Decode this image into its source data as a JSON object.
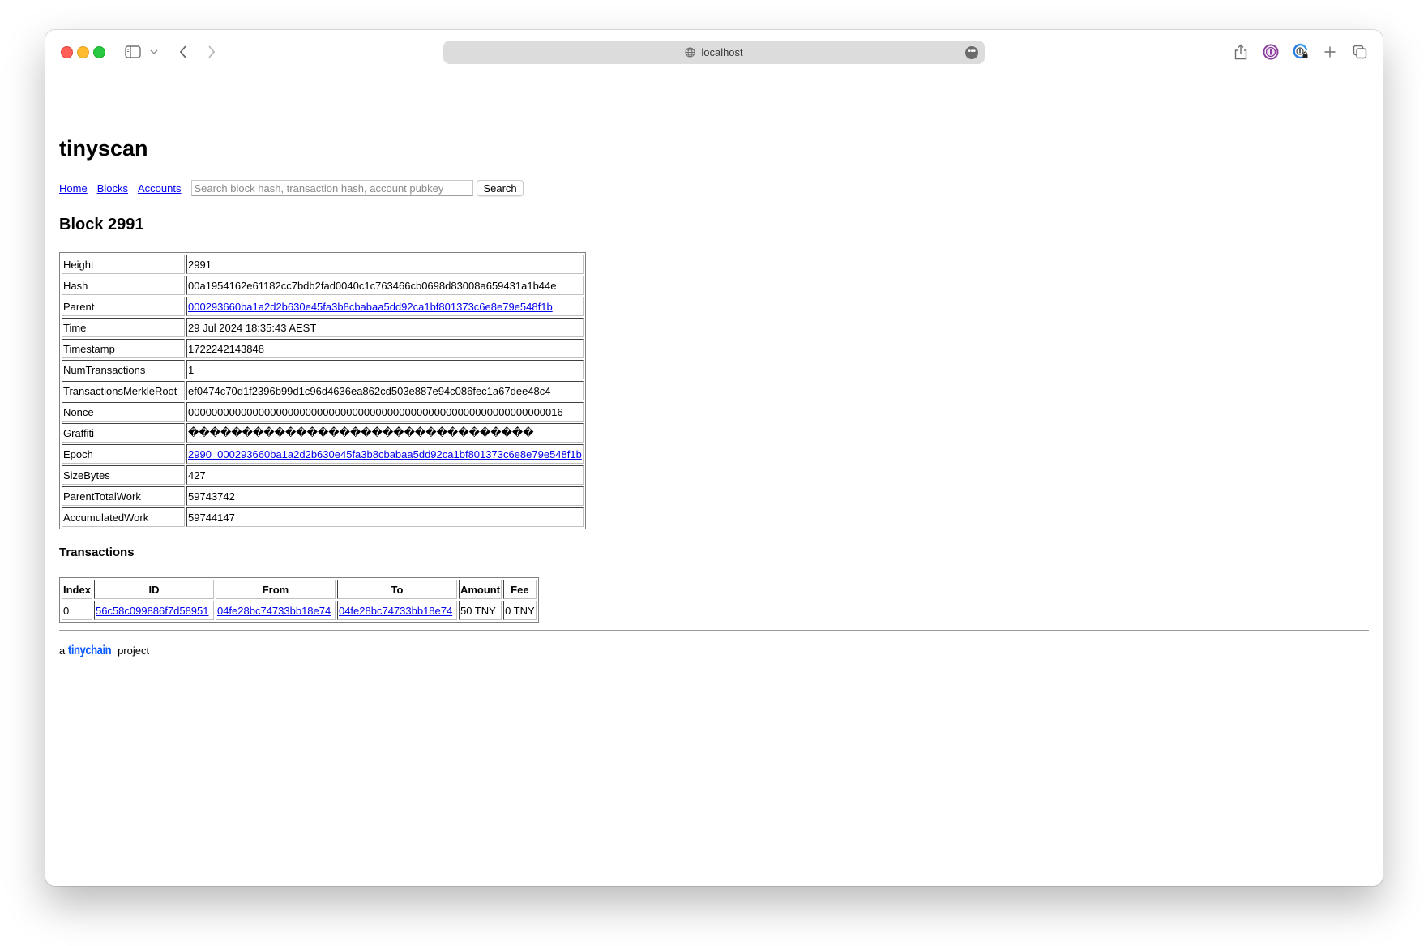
{
  "browser": {
    "url": "localhost",
    "icons": {
      "sidebar": "sidebar-icon",
      "back": "chevron-left-icon",
      "forward": "chevron-right-icon",
      "share": "share-icon",
      "onepassword": "onepassword-icon",
      "passwords": "password-lock-icon",
      "new_tab": "plus-icon",
      "tab_overview": "tabs-icon"
    }
  },
  "site": {
    "title": "tinyscan",
    "nav": [
      {
        "label": "Home"
      },
      {
        "label": "Blocks"
      },
      {
        "label": "Accounts"
      }
    ],
    "search": {
      "value": "",
      "placeholder": "Search block hash, transaction hash, account pubkey",
      "button_label": "Search"
    }
  },
  "block": {
    "heading": "Block 2991",
    "fields": [
      {
        "key": "Height",
        "value": "2991",
        "link": false
      },
      {
        "key": "Hash",
        "value": "00a1954162e61182cc7bdb2fad0040c1c763466cb0698d83008a659431a1b44e",
        "link": false
      },
      {
        "key": "Parent",
        "value": "000293660ba1a2d2b630e45fa3b8cbabaa5dd92ca1bf801373c6e8e79e548f1b",
        "link": true
      },
      {
        "key": "Time",
        "value": "29 Jul 2024 18:35:43 AEST",
        "link": false
      },
      {
        "key": "Timestamp",
        "value": "1722242143848",
        "link": false
      },
      {
        "key": "NumTransactions",
        "value": "1",
        "link": false
      },
      {
        "key": "TransactionsMerkleRoot",
        "value": "ef0474c70d1f2396b99d1c96d4636ea862cd503e887e94c086fec1a67dee48c4",
        "link": false
      },
      {
        "key": "Nonce",
        "value": "0000000000000000000000000000000000000000000000000000000000000016",
        "link": false
      },
      {
        "key": "Graffiti",
        "value": "��������������������������������",
        "link": false
      },
      {
        "key": "Epoch",
        "value": "2990_000293660ba1a2d2b630e45fa3b8cbabaa5dd92ca1bf801373c6e8e79e548f1b",
        "link": true
      },
      {
        "key": "SizeBytes",
        "value": "427",
        "link": false
      },
      {
        "key": "ParentTotalWork",
        "value": "59743742",
        "link": false
      },
      {
        "key": "AccumulatedWork",
        "value": "59744147",
        "link": false
      }
    ]
  },
  "transactions": {
    "heading": "Transactions",
    "columns": [
      "Index",
      "ID",
      "From",
      "To",
      "Amount",
      "Fee"
    ],
    "rows": [
      {
        "index": "0",
        "id": "56c58c099886f7d58951",
        "from": "04fe28bc74733bb18e74",
        "to": "04fe28bc74733bb18e74",
        "amount": "50 TNY",
        "fee": "0 TNY"
      }
    ]
  },
  "footer": {
    "prefix": "a",
    "brand": "tinychain",
    "suffix": "project",
    "brand_color": "#0a5bff"
  }
}
